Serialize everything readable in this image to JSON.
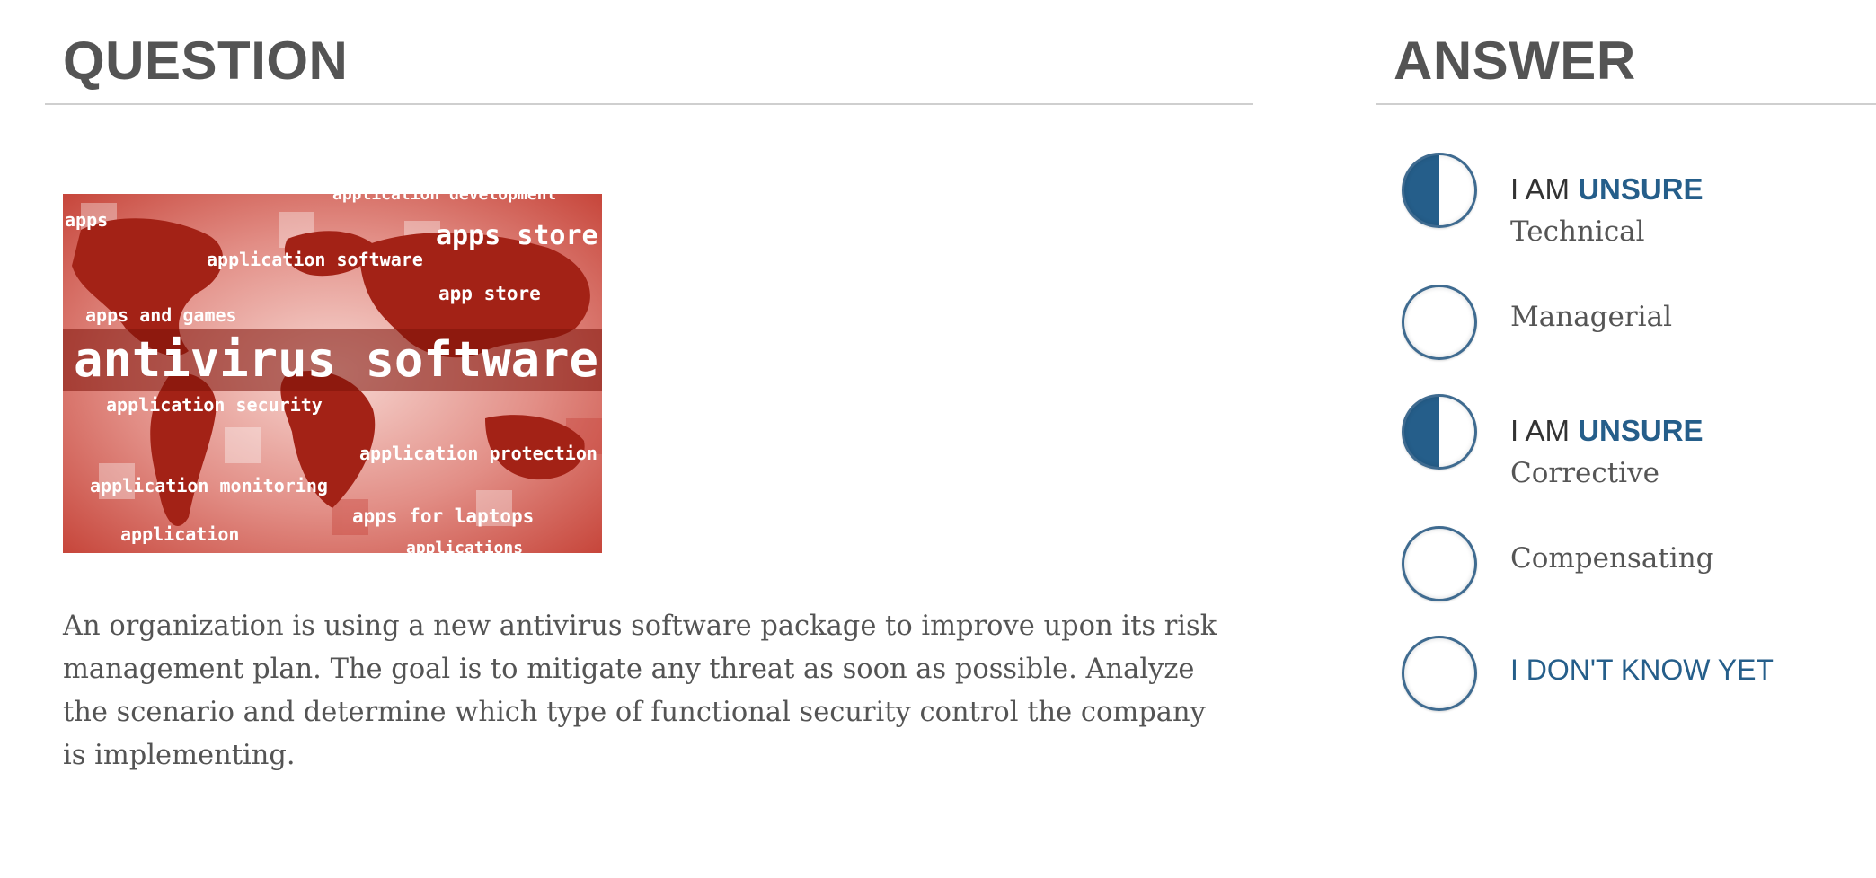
{
  "question_panel": {
    "title": "QUESTION",
    "text": "An organization is using a new antivirus software package to improve upon its risk management plan. The goal is to mitigate any threat as soon as possible. Analyze the scenario and determine which type of functional security control the company is implementing.",
    "illustration": {
      "headline": "antivirus software",
      "words": [
        "application development",
        "apps",
        "apps store",
        "application software",
        "app store",
        "apps and games",
        "application security",
        "application protection",
        "application monitoring",
        "apps for laptops",
        "application",
        "applications"
      ]
    }
  },
  "answer_panel": {
    "title": "ANSWER",
    "unsure_prefix": "I AM ",
    "unsure_highlight": "UNSURE",
    "options": [
      {
        "label": "Technical",
        "state": "unsure"
      },
      {
        "label": "Managerial",
        "state": "empty"
      },
      {
        "label": "Corrective",
        "state": "unsure"
      },
      {
        "label": "Compensating",
        "state": "empty"
      }
    ],
    "dont_know_label": "I DON'T KNOW YET"
  },
  "colors": {
    "accent": "#255e8a",
    "header_text": "#545454",
    "body_text": "#545454",
    "illustration_red": "#a32216"
  }
}
